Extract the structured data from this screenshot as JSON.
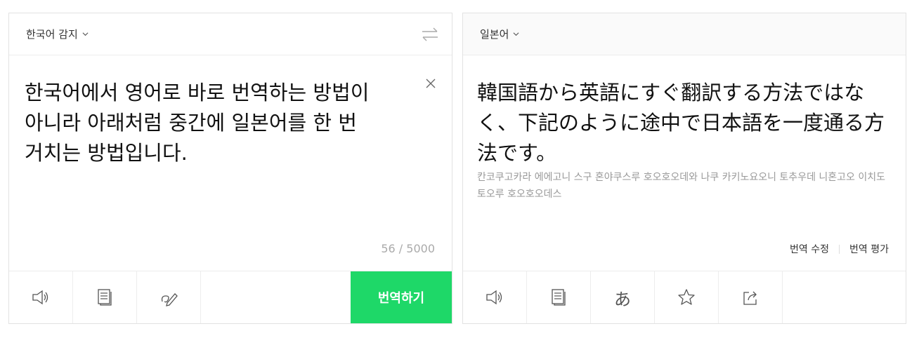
{
  "source": {
    "language": "한국어 감지",
    "text": "한국어에서 영어로 바로 번역하는 방법이 아니라 아래처럼 중간에 일본어를 한 번 거치는 방법입니다.",
    "char_count": "56 / 5000",
    "translate_button": "번역하기",
    "tools": [
      "speaker-icon",
      "dictionary-icon",
      "handwriting-icon"
    ]
  },
  "target": {
    "language": "일본어",
    "text": "韓国語から英語にすぐ翻訳する方法ではなく、下記のように途中で日本語を一度通る方法です。",
    "pronunciation": "칸코쿠고카라 에에고니 스구 혼야쿠스루 호오호오데와 나쿠 카키노요오니 토추우데 니혼고오 이치도 토오루 호오호오데스",
    "edit_label": "번역 수정",
    "rate_label": "번역 평가",
    "hiragana_glyph": "あ",
    "tools": [
      "speaker-icon",
      "dictionary-icon",
      "hiragana-icon",
      "star-icon",
      "share-icon"
    ]
  },
  "colors": {
    "accent": "#1ed868",
    "border": "#e2e2e2",
    "muted": "#aaaaaa"
  }
}
